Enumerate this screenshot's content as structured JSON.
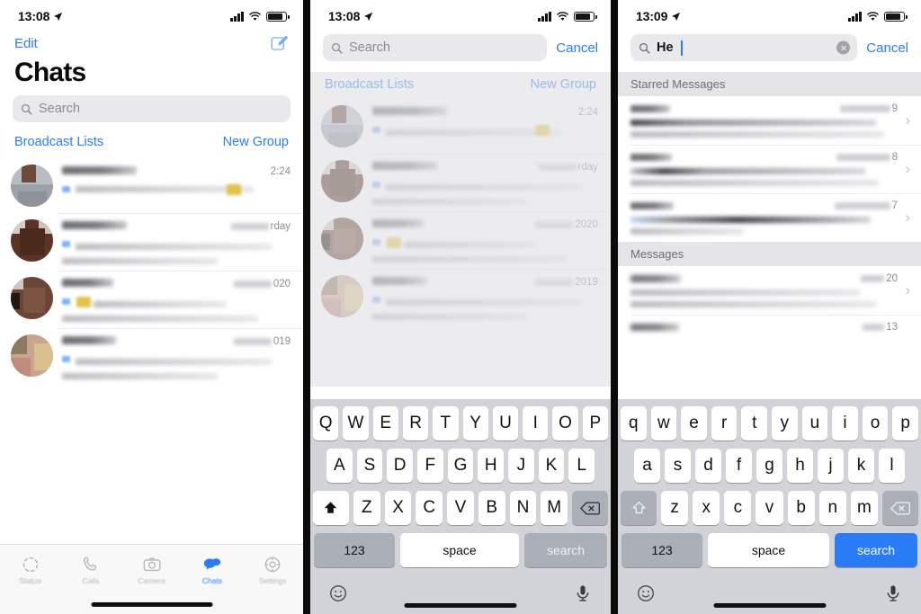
{
  "panels": [
    {
      "id": "chats-list",
      "status_bar": {
        "time": "13:08",
        "location_icon": "location-arrow-icon",
        "signal_icon": "cellular-signal-icon",
        "wifi_icon": "wifi-icon",
        "battery_icon": "battery-icon"
      },
      "nav": {
        "edit_label": "Edit",
        "compose_icon": "compose-icon"
      },
      "title": "Chats",
      "search": {
        "placeholder": "Search",
        "value": "",
        "icon": "search-icon"
      },
      "section_links": {
        "left": "Broadcast Lists",
        "right": "New Group"
      },
      "rows": [
        {
          "timestamp": "2:24",
          "masked": false
        },
        {
          "timestamp": "rday",
          "masked": true
        },
        {
          "timestamp": "020",
          "masked": true
        },
        {
          "timestamp": "019",
          "masked": true
        }
      ],
      "tabbar": [
        {
          "label": "Status",
          "icon": "status-ring-icon",
          "active": false
        },
        {
          "label": "Calls",
          "icon": "phone-icon",
          "active": false
        },
        {
          "label": "Camera",
          "icon": "camera-icon",
          "active": false
        },
        {
          "label": "Chats",
          "icon": "chat-bubbles-icon",
          "active": true
        },
        {
          "label": "Settings",
          "icon": "gear-icon",
          "active": false
        }
      ]
    },
    {
      "id": "search-empty",
      "status_bar": {
        "time": "13:08",
        "location_icon": "location-arrow-icon",
        "signal_icon": "cellular-signal-icon",
        "wifi_icon": "wifi-icon",
        "battery_icon": "battery-icon"
      },
      "search": {
        "placeholder": "Search",
        "value": "",
        "icon": "search-icon",
        "cancel_label": "Cancel"
      },
      "section_links": {
        "left": "Broadcast Lists",
        "right": "New Group"
      },
      "rows": [
        {
          "timestamp": "2:24",
          "masked": false
        },
        {
          "timestamp": "rday",
          "masked": true
        },
        {
          "timestamp": "2020",
          "masked": true
        },
        {
          "timestamp": "2019",
          "masked": true
        }
      ],
      "keyboard": {
        "shift_state": "uppercase",
        "row1": [
          "Q",
          "W",
          "E",
          "R",
          "T",
          "Y",
          "U",
          "I",
          "O",
          "P"
        ],
        "row2": [
          "A",
          "S",
          "D",
          "F",
          "G",
          "H",
          "J",
          "K",
          "L"
        ],
        "row3": [
          "Z",
          "X",
          "C",
          "V",
          "B",
          "N",
          "M"
        ],
        "shift_icon": "shift-filled-icon",
        "backspace_icon": "backspace-icon",
        "numbers_label": "123",
        "space_label": "space",
        "action_label": "search",
        "action_enabled": false,
        "emoji_icon": "emoji-icon",
        "mic_icon": "microphone-icon"
      }
    },
    {
      "id": "search-results",
      "status_bar": {
        "time": "13:09",
        "location_icon": "location-arrow-icon",
        "signal_icon": "cellular-signal-icon",
        "wifi_icon": "wifi-icon",
        "battery_icon": "battery-icon"
      },
      "search": {
        "placeholder": "Search",
        "value": "He",
        "icon": "search-icon",
        "clear_icon": "clear-circle-icon",
        "cancel_label": "Cancel"
      },
      "groups": [
        {
          "header": "Starred Messages",
          "rows": [
            {
              "timestamp": "9",
              "chevron_icon": "chevron-right-icon"
            },
            {
              "timestamp": "8",
              "chevron_icon": "chevron-right-icon"
            },
            {
              "timestamp": "7",
              "chevron_icon": "chevron-right-icon"
            }
          ]
        },
        {
          "header": "Messages",
          "rows": [
            {
              "timestamp": "20",
              "chevron_icon": "chevron-right-icon"
            },
            {
              "timestamp": "13",
              "chevron_icon": "chevron-right-icon"
            }
          ]
        }
      ],
      "keyboard": {
        "shift_state": "lowercase",
        "row1": [
          "q",
          "w",
          "e",
          "r",
          "t",
          "y",
          "u",
          "i",
          "o",
          "p"
        ],
        "row2": [
          "a",
          "s",
          "d",
          "f",
          "g",
          "h",
          "j",
          "k",
          "l"
        ],
        "row3": [
          "z",
          "x",
          "c",
          "v",
          "b",
          "n",
          "m"
        ],
        "shift_icon": "shift-outline-icon",
        "backspace_icon": "backspace-icon",
        "numbers_label": "123",
        "space_label": "space",
        "action_label": "search",
        "action_enabled": true,
        "emoji_icon": "emoji-icon",
        "mic_icon": "microphone-icon"
      }
    }
  ],
  "colors": {
    "accent": "#2a7cf6",
    "keyboard_bg": "#d1d3d9",
    "key_dark": "#aaafb8",
    "group_header_bg": "#e4e4e7",
    "search_bg": "#e9e9eb"
  }
}
